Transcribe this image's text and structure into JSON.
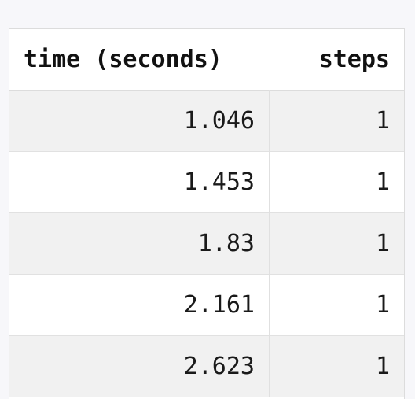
{
  "table": {
    "headers": {
      "time": "time (seconds)",
      "steps": "steps"
    },
    "rows": [
      {
        "time": "1.046",
        "steps": "1"
      },
      {
        "time": "1.453",
        "steps": "1"
      },
      {
        "time": "1.83",
        "steps": "1"
      },
      {
        "time": "2.161",
        "steps": "1"
      },
      {
        "time": "2.623",
        "steps": "1"
      }
    ]
  }
}
